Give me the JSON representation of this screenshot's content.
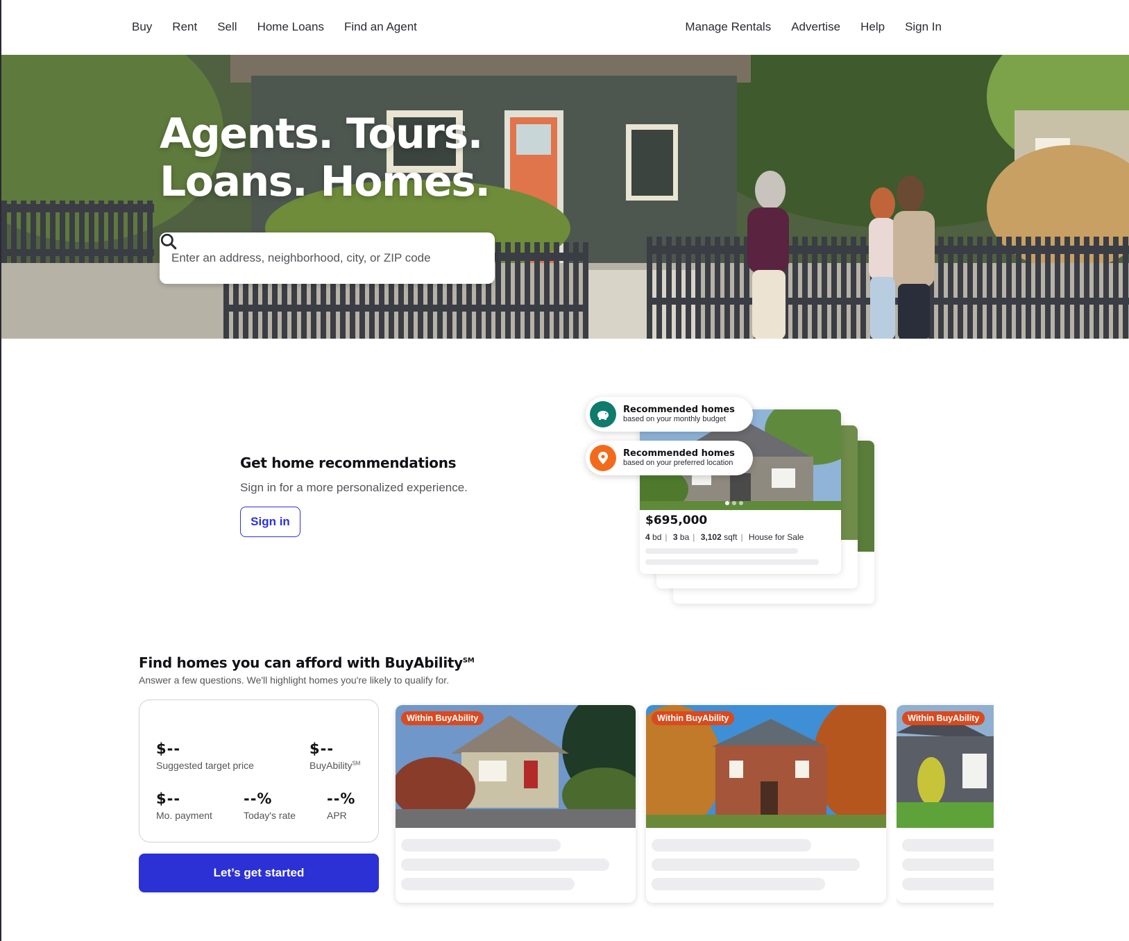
{
  "nav": {
    "left": [
      "Buy",
      "Rent",
      "Sell",
      "Home Loans",
      "Find an Agent"
    ],
    "right": [
      "Manage Rentals",
      "Advertise",
      "Help",
      "Sign In"
    ]
  },
  "hero": {
    "title_line1": "Agents. Tours.",
    "title_line2": "Loans. Homes.",
    "search_placeholder": "Enter an address, neighborhood, city, or ZIP code",
    "search_icon": "search-icon"
  },
  "recommendations": {
    "title": "Get home recommendations",
    "subtitle": "Sign in for a more personalized experience.",
    "button": "Sign in",
    "pill_budget_title": "Recommended homes",
    "pill_budget_sub": "based on your monthly budget",
    "pill_location_title": "Recommended homes",
    "pill_location_sub": "based on your preferred location",
    "sample_price": "$695,000",
    "sample_beds": "4",
    "sample_beds_unit": "bd",
    "sample_baths": "3",
    "sample_baths_unit": "ba",
    "sample_sqft": "3,102",
    "sample_sqft_unit": "sqft",
    "sample_type": "House for Sale"
  },
  "buyability": {
    "title": "Find homes you can afford with BuyAbility",
    "title_mark": "SM",
    "subtitle": "Answer a few questions. We'll highlight homes you're likely to qualify for.",
    "target_price_value": "$--",
    "target_price_label": "Suggested target price",
    "buyability_value": "$--",
    "buyability_label": "BuyAbility",
    "buyability_mark": "SM",
    "payment_value": "$--",
    "payment_label": "Mo. payment",
    "rate_value": "--%",
    "rate_label": "Today's rate",
    "apr_value": "--%",
    "apr_label": "APR",
    "button": "Let’s get started",
    "badge": "Within BuyAbility"
  },
  "colors": {
    "accent": "#2c31d6",
    "badge": "#d94a1f",
    "budget_icon": "#0f7b6c",
    "location_icon": "#f26b1d"
  }
}
